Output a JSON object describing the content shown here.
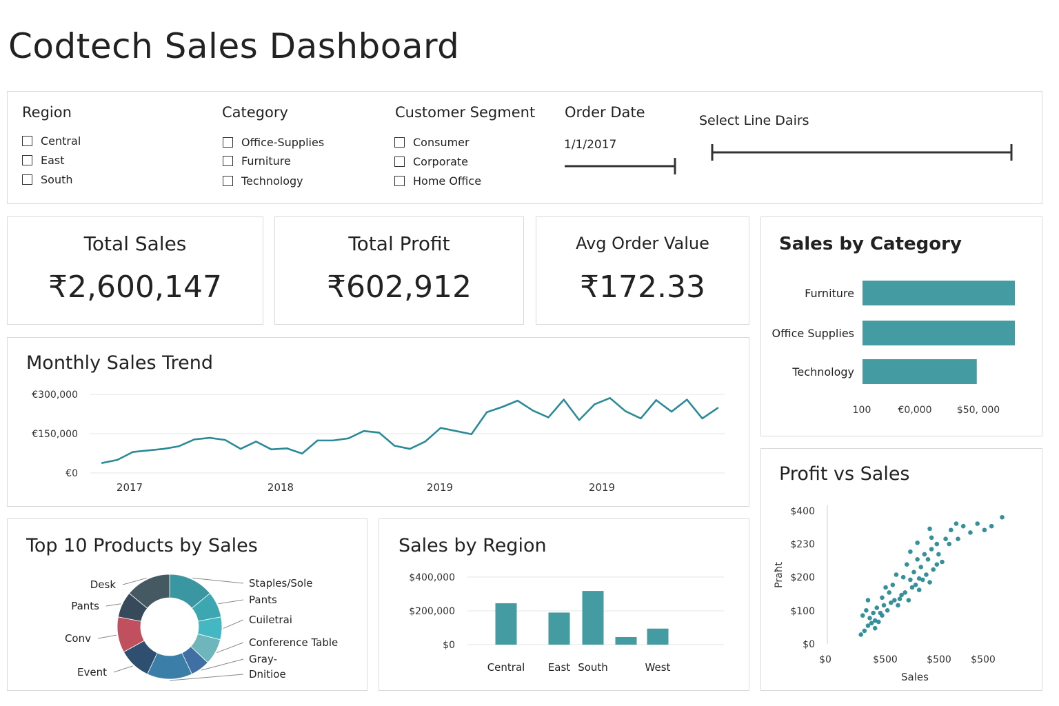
{
  "page": {
    "title": "Codtech Sales Dashboard"
  },
  "filters": {
    "region": {
      "label": "Region",
      "options": [
        "Central",
        "East",
        "South"
      ]
    },
    "category": {
      "label": "Category",
      "options": [
        "Office-Supplies",
        "Furniture",
        "Technology"
      ]
    },
    "segment": {
      "label": "Customer Segment",
      "options": [
        "Consumer",
        "Corporate",
        "Home Office"
      ]
    },
    "order_date": {
      "label": "Order Date",
      "value": "1/1/2017"
    },
    "date_range": {
      "label": "Select Line Dairs"
    }
  },
  "kpis": {
    "total_sales": {
      "label": "Total Sales",
      "value": "₹2,600,147"
    },
    "total_profit": {
      "label": "Total Profit",
      "value": "₹602,912"
    },
    "avg_order": {
      "label": "Avg Order Value",
      "value": "₹172.33"
    }
  },
  "colors": {
    "accent": "#449ba2",
    "line": "#2a8a96",
    "grid": "#e6e6e6"
  },
  "chart_data": [
    {
      "id": "sales_by_category",
      "type": "bar",
      "orientation": "horizontal",
      "title": "Sales by Category",
      "categories": [
        "Furniture",
        "Office Supplies",
        "Technology"
      ],
      "values": [
        100,
        100,
        75
      ],
      "x_tick_labels": [
        "100",
        "€0,000",
        "$50, 000"
      ]
    },
    {
      "id": "monthly_sales_trend",
      "type": "line",
      "title": "Monthly Sales Trend",
      "y_tick_labels": [
        "€300,000",
        "€150,000",
        "€0"
      ],
      "y_ticks": [
        300000,
        150000,
        0
      ],
      "ylim": [
        0,
        300000
      ],
      "x_tick_labels": [
        "2017",
        "2018",
        "2019",
        "2019"
      ],
      "values": [
        38000,
        50000,
        80000,
        86000,
        92000,
        102000,
        128000,
        134000,
        126000,
        92000,
        120000,
        90000,
        94000,
        74000,
        124000,
        124000,
        132000,
        160000,
        154000,
        104000,
        92000,
        120000,
        172000,
        160000,
        148000,
        232000,
        252000,
        276000,
        238000,
        212000,
        280000,
        202000,
        262000,
        286000,
        236000,
        208000,
        278000,
        234000,
        280000,
        208000,
        248000
      ]
    },
    {
      "id": "top10_products",
      "type": "pie",
      "variant": "donut",
      "title": "Top 10 Products by Sales",
      "labels": [
        "Staples/Sole",
        "Pants",
        "Cuiletrai",
        "Conference  Table",
        "Gray-",
        "Dnitioe",
        "Event",
        "Conv",
        "Pants",
        "Desk"
      ],
      "values": [
        14,
        8,
        7,
        8,
        6,
        14,
        10,
        11,
        8,
        14
      ],
      "colors": [
        "#3a97a2",
        "#3ca7b0",
        "#43b8c2",
        "#6eb6bb",
        "#3f6fa3",
        "#3b7fa8",
        "#2f4f70",
        "#c0505e",
        "#374a5c",
        "#455963"
      ]
    },
    {
      "id": "sales_by_region",
      "type": "bar",
      "title": "Sales by Region",
      "categories": [
        "Central",
        "East",
        "South",
        "",
        "West"
      ],
      "values": [
        245000,
        190000,
        318000,
        45000,
        95000
      ],
      "y_tick_labels": [
        "$400,000",
        "$200,000",
        "$0"
      ],
      "y_ticks": [
        400000,
        200000,
        0
      ],
      "ylim": [
        0,
        400000
      ]
    },
    {
      "id": "profit_vs_sales",
      "type": "scatter",
      "title": "Profit vs Sales",
      "xlabel": "Sales",
      "ylabel": "Praħt",
      "y_tick_labels": [
        "$400",
        "$230",
        "$200",
        "$100",
        "$0"
      ],
      "x_tick_labels": [
        "$0",
        "$500",
        "$500",
        "$500"
      ],
      "points": [
        [
          0.12,
          0.03
        ],
        [
          0.14,
          0.06
        ],
        [
          0.16,
          0.1
        ],
        [
          0.18,
          0.12
        ],
        [
          0.2,
          0.14
        ],
        [
          0.22,
          0.13
        ],
        [
          0.13,
          0.18
        ],
        [
          0.15,
          0.22
        ],
        [
          0.17,
          0.16
        ],
        [
          0.19,
          0.2
        ],
        [
          0.21,
          0.24
        ],
        [
          0.23,
          0.2
        ],
        [
          0.25,
          0.26
        ],
        [
          0.27,
          0.22
        ],
        [
          0.29,
          0.28
        ],
        [
          0.31,
          0.3
        ],
        [
          0.33,
          0.26
        ],
        [
          0.35,
          0.34
        ],
        [
          0.37,
          0.36
        ],
        [
          0.39,
          0.3
        ],
        [
          0.41,
          0.4
        ],
        [
          0.43,
          0.42
        ],
        [
          0.45,
          0.38
        ],
        [
          0.47,
          0.46
        ],
        [
          0.49,
          0.5
        ],
        [
          0.51,
          0.44
        ],
        [
          0.53,
          0.54
        ],
        [
          0.55,
          0.58
        ],
        [
          0.36,
          0.48
        ],
        [
          0.38,
          0.58
        ],
        [
          0.42,
          0.52
        ],
        [
          0.44,
          0.62
        ],
        [
          0.46,
          0.56
        ],
        [
          0.48,
          0.66
        ],
        [
          0.5,
          0.62
        ],
        [
          0.52,
          0.7
        ],
        [
          0.56,
          0.66
        ],
        [
          0.58,
          0.6
        ],
        [
          0.3,
          0.42
        ],
        [
          0.28,
          0.36
        ],
        [
          0.24,
          0.32
        ],
        [
          0.32,
          0.5
        ],
        [
          0.26,
          0.4
        ],
        [
          0.4,
          0.46
        ],
        [
          0.6,
          0.78
        ],
        [
          0.63,
          0.85
        ],
        [
          0.67,
          0.78
        ],
        [
          0.7,
          0.88
        ],
        [
          0.74,
          0.83
        ],
        [
          0.78,
          0.9
        ],
        [
          0.82,
          0.85
        ],
        [
          0.86,
          0.88
        ],
        [
          0.92,
          0.95
        ],
        [
          0.62,
          0.74
        ],
        [
          0.66,
          0.9
        ],
        [
          0.51,
          0.86
        ],
        [
          0.55,
          0.74
        ],
        [
          0.52,
          0.79
        ],
        [
          0.44,
          0.75
        ],
        [
          0.4,
          0.68
        ],
        [
          0.16,
          0.3
        ],
        [
          0.2,
          0.08
        ],
        [
          0.24,
          0.18
        ],
        [
          0.34,
          0.31
        ],
        [
          0.45,
          0.47
        ]
      ]
    }
  ]
}
